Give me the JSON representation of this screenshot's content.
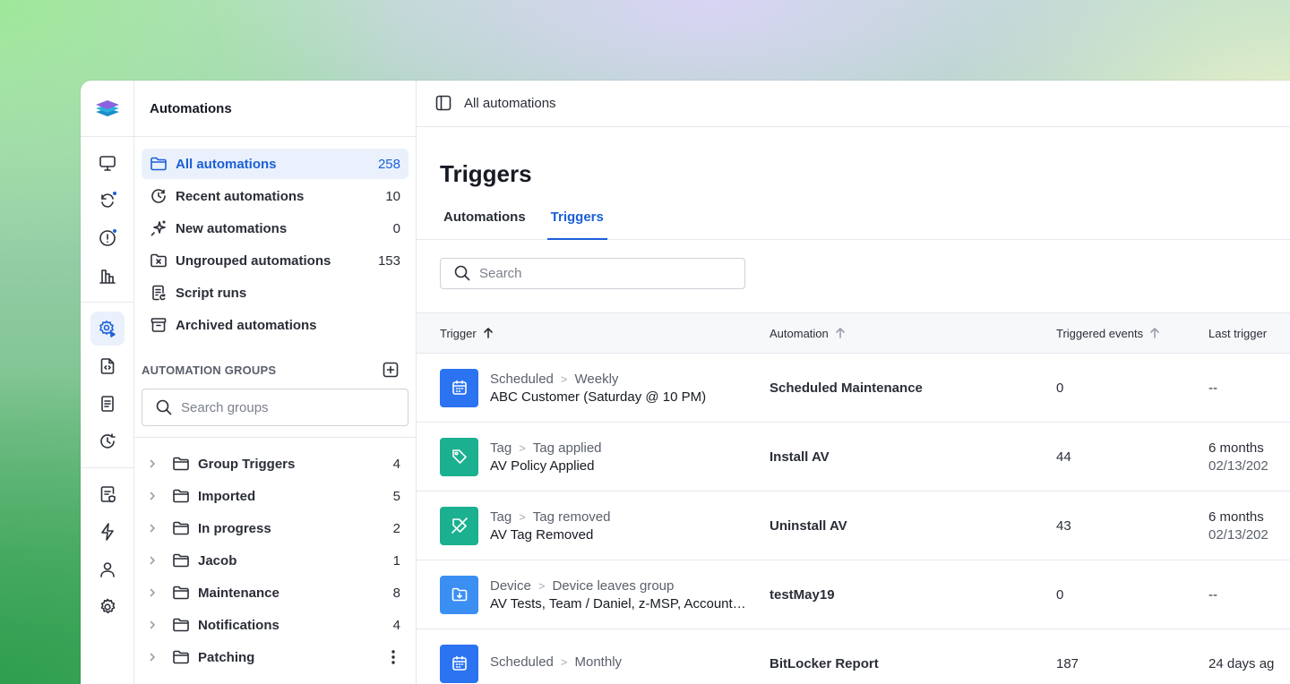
{
  "sidebar": {
    "title": "Automations",
    "nav": [
      {
        "label": "All automations",
        "count": "258",
        "icon": "folder-icon"
      },
      {
        "label": "Recent automations",
        "count": "10",
        "icon": "history-icon"
      },
      {
        "label": "New automations",
        "count": "0",
        "icon": "sparkle-icon"
      },
      {
        "label": "Ungrouped automations",
        "count": "153",
        "icon": "folder-x-icon"
      },
      {
        "label": "Script runs",
        "count": "",
        "icon": "script-icon"
      },
      {
        "label": "Archived automations",
        "count": "",
        "icon": "archive-icon"
      }
    ],
    "groups_heading": "AUTOMATION GROUPS",
    "groups_search_placeholder": "Search groups",
    "groups": [
      {
        "label": "Group Triggers",
        "count": "4"
      },
      {
        "label": "Imported",
        "count": "5"
      },
      {
        "label": "In progress",
        "count": "2"
      },
      {
        "label": "Jacob",
        "count": "1"
      },
      {
        "label": "Maintenance",
        "count": "8"
      },
      {
        "label": "Notifications",
        "count": "4"
      },
      {
        "label": "Patching",
        "count": ""
      }
    ]
  },
  "topbar": {
    "breadcrumb": "All automations"
  },
  "main": {
    "title": "Triggers",
    "tabs": [
      {
        "label": "Automations",
        "active": false
      },
      {
        "label": "Triggers",
        "active": true
      }
    ],
    "search_placeholder": "Search"
  },
  "table": {
    "columns": [
      "Trigger",
      "Automation",
      "Triggered events",
      "Last trigger"
    ],
    "rows": [
      {
        "type": "Scheduled",
        "subtype": "Weekly",
        "name": "ABC Customer (Saturday @ 10 PM)",
        "automation": "Scheduled Maintenance",
        "events": "0",
        "last": "--",
        "last_sub": "",
        "icon": "calendar-icon",
        "color": "#2b73f0"
      },
      {
        "type": "Tag",
        "subtype": "Tag applied",
        "name": "AV Policy Applied",
        "automation": "Install AV",
        "events": "44",
        "last": "6 months",
        "last_sub": "02/13/202",
        "icon": "tag-icon",
        "color": "#1bb090"
      },
      {
        "type": "Tag",
        "subtype": "Tag removed",
        "name": "AV Tag Removed",
        "automation": "Uninstall AV",
        "events": "43",
        "last": "6 months",
        "last_sub": "02/13/202",
        "icon": "tag-off-icon",
        "color": "#1bb090"
      },
      {
        "type": "Device",
        "subtype": "Device leaves group",
        "name": "AV Tests, Team / Daniel, z-MSP, Account…",
        "automation": "testMay19",
        "events": "0",
        "last": "--",
        "last_sub": "",
        "icon": "folder-out-icon",
        "color": "#3b8ff3"
      },
      {
        "type": "Scheduled",
        "subtype": "Monthly",
        "name": "",
        "automation": "BitLocker Report",
        "events": "187",
        "last": "24 days ag",
        "last_sub": "",
        "icon": "calendar-icon",
        "color": "#2b73f0"
      }
    ]
  }
}
